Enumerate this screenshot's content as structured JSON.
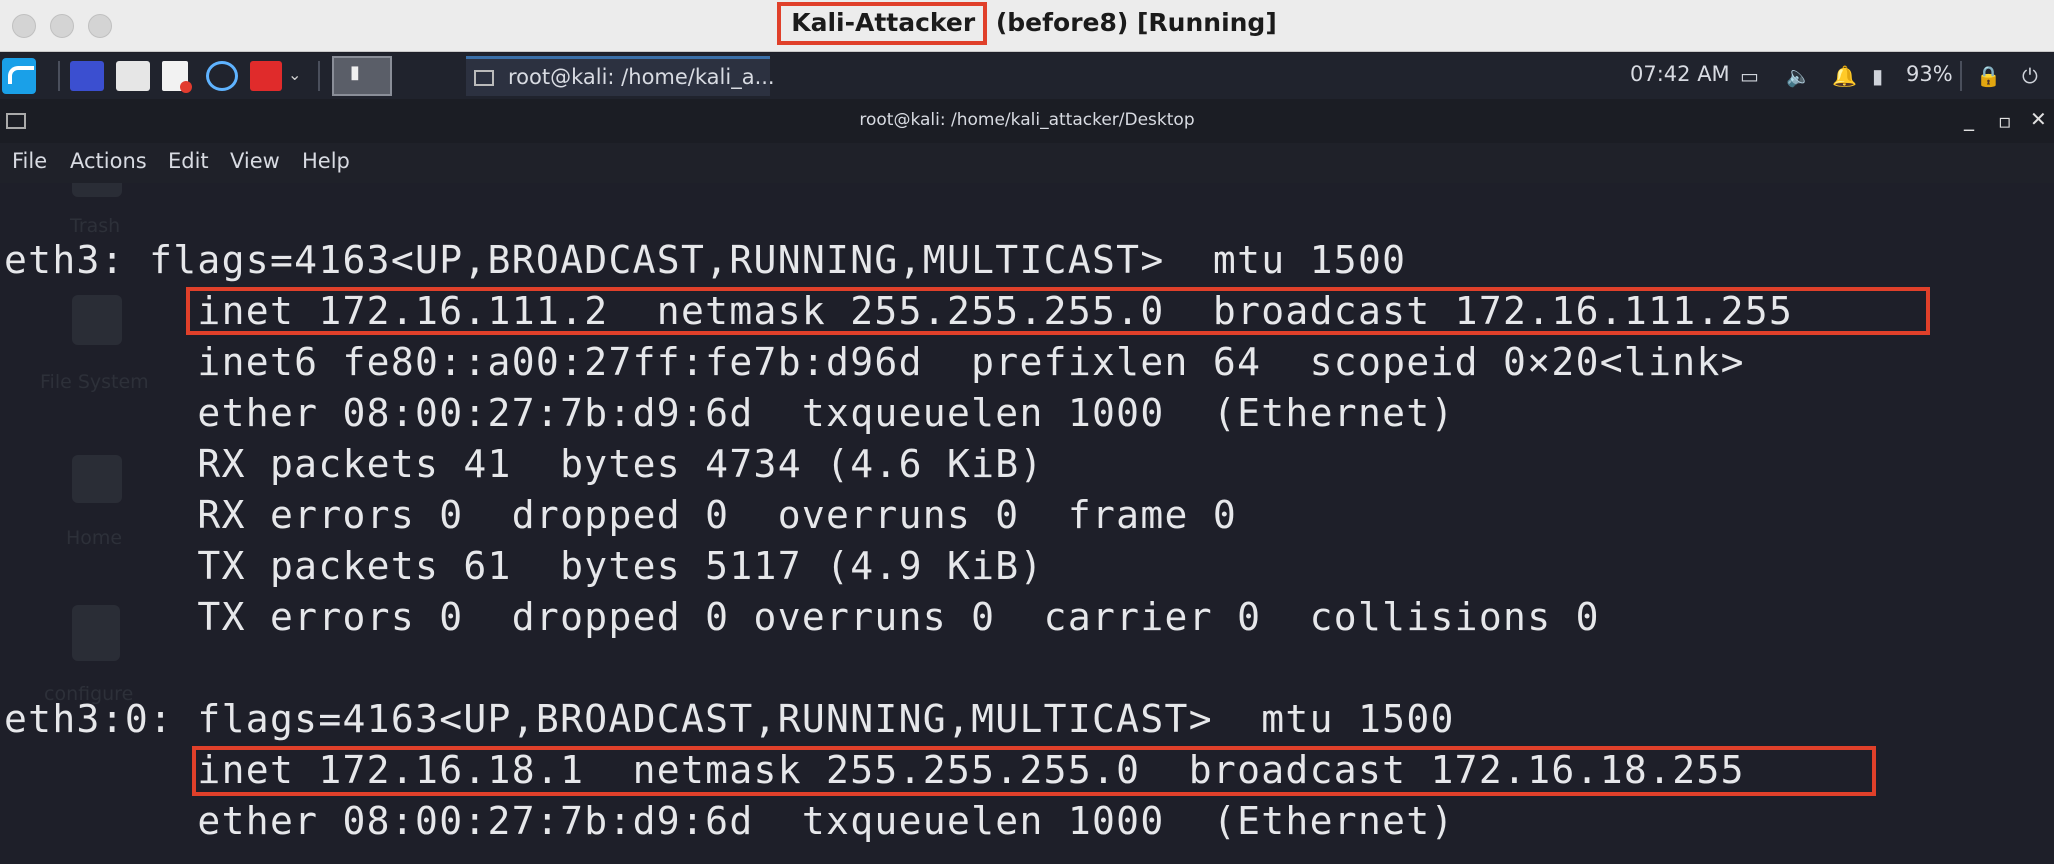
{
  "mac": {
    "title_highlight": "Kali-Attacker",
    "title_rest": " (before8) [Running]"
  },
  "panel": {
    "task_label": "root@kali: /home/kali_a...",
    "clock": "07:42 AM",
    "battery": "93%",
    "icons": [
      "kali-menu-icon",
      "workspace-icon",
      "file-manager-icon",
      "text-editor-icon",
      "browser-icon",
      "terminal-red-icon",
      "dropdown-chevron-icon",
      "terminal-icon",
      "display-icon",
      "volume-icon",
      "notifications-icon",
      "battery-icon",
      "lock-icon",
      "power-icon"
    ]
  },
  "terminal": {
    "window_title": "root@kali: /home/kali_attacker/Desktop",
    "menu": [
      "File",
      "Actions",
      "Edit",
      "View",
      "Help"
    ],
    "desktop_ghosts": [
      "Trash",
      "File System",
      "Home",
      "configure"
    ],
    "lines": [
      "eth3: flags=4163<UP,BROADCAST,RUNNING,MULTICAST>  mtu 1500",
      "        inet 172.16.111.2  netmask 255.255.255.0  broadcast 172.16.111.255",
      "        inet6 fe80::a00:27ff:fe7b:d96d  prefixlen 64  scopeid 0×20<link>",
      "        ether 08:00:27:7b:d9:6d  txqueuelen 1000  (Ethernet)",
      "        RX packets 41  bytes 4734 (4.6 KiB)",
      "        RX errors 0  dropped 0  overruns 0  frame 0",
      "        TX packets 61  bytes 5117 (4.9 KiB)",
      "        TX errors 0  dropped 0 overruns 0  carrier 0  collisions 0",
      "",
      "eth3:0: flags=4163<UP,BROADCAST,RUNNING,MULTICAST>  mtu 1500",
      "        inet 172.16.18.1  netmask 255.255.255.0  broadcast 172.16.18.255",
      "        ether 08:00:27:7b:d9:6d  txqueuelen 1000  (Ethernet)"
    ]
  },
  "colors": {
    "highlight": "#e0402a",
    "terminal_bg": "#1e1f29"
  }
}
